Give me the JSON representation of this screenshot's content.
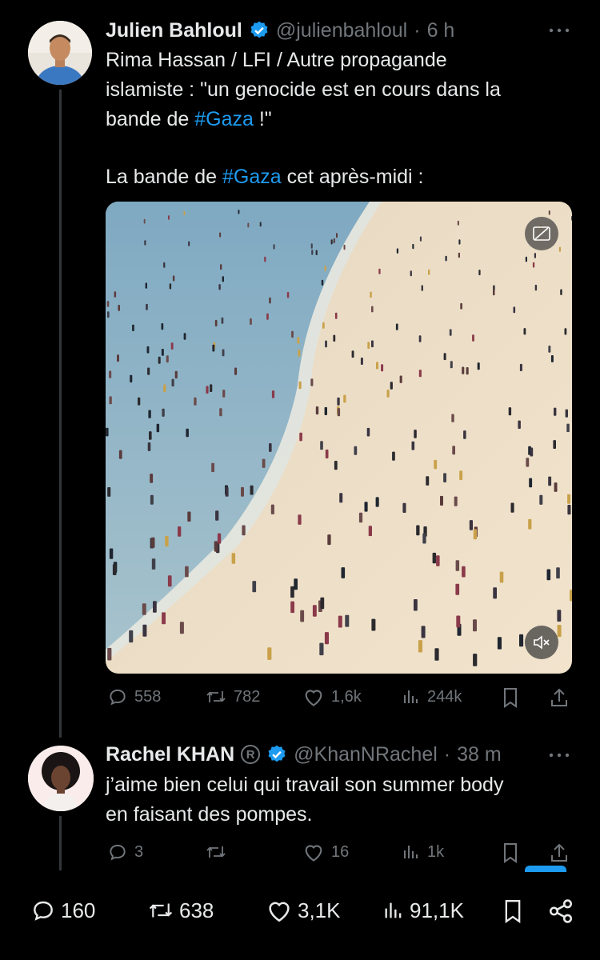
{
  "tweet1": {
    "author": "Julien Bahloul",
    "handle": "@julienbahloul",
    "separator": "·",
    "time": "6 h",
    "text": {
      "line1": "Rima Hassan / LFI / Autre propagande",
      "line2": "islamiste : \"un genocide est en cours dans la",
      "line3_pre": "bande de ",
      "line3_tag": "#Gaza",
      "line3_post": " !\"",
      "line4_pre": "La bande de ",
      "line4_tag": "#Gaza",
      "line4_post": " cet après-midi :"
    },
    "metrics": {
      "replies": "558",
      "reposts": "782",
      "likes": "1,6k",
      "views": "244k"
    }
  },
  "reply": {
    "author": "Rachel KHAN",
    "registered_mark": "R",
    "handle": "@KhanNRachel",
    "separator": "·",
    "time": "38 m",
    "line1": "j’aime bien celui qui travail son summer body",
    "line2": "en faisant des pompes.",
    "metrics": {
      "replies": "3",
      "reposts": "",
      "likes": "16",
      "views": "1k"
    }
  },
  "bottom_bar": {
    "replies": "160",
    "reposts": "638",
    "likes": "3,1K",
    "views": "91,1K"
  },
  "colors": {
    "accent": "#1d9bf0",
    "muted": "#71767b",
    "background": "#000000"
  },
  "icons": [
    "verified-badge-icon",
    "more-icon",
    "reply-icon",
    "repost-icon",
    "like-icon",
    "views-icon",
    "bookmark-icon",
    "share-icon",
    "mute-icon",
    "caption-icon"
  ]
}
